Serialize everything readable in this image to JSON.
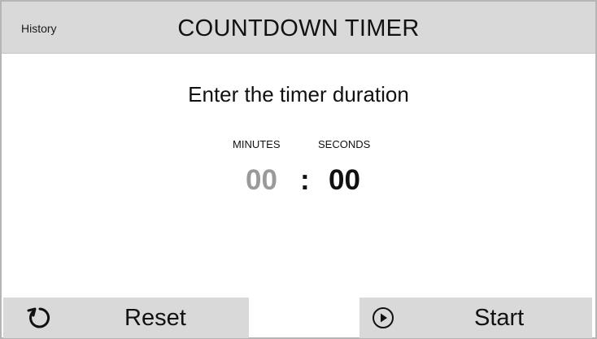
{
  "header": {
    "history_label": "History",
    "title": "COUNTDOWN TIMER"
  },
  "main": {
    "prompt": "Enter the timer duration",
    "minutes_label": "MINUTES",
    "seconds_label": "SECONDS",
    "minutes_value": "00",
    "separator": ":",
    "seconds_value": "00"
  },
  "footer": {
    "reset_label": "Reset",
    "reset_icon": "reset-icon",
    "start_label": "Start",
    "start_icon": "play-icon"
  },
  "colors": {
    "header_bg": "#d9d9d9",
    "button_bg": "#d9d9d9",
    "inactive_digits": "#9a9a9a",
    "text": "#111111"
  }
}
